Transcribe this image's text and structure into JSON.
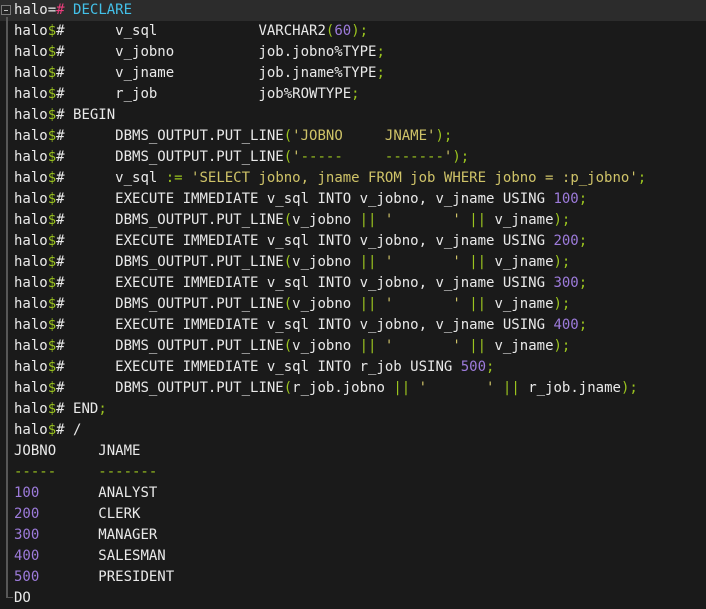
{
  "terminal": {
    "colors": {
      "background": "#1a1a1a",
      "active_line_background": "#2c2c2c",
      "fg": "#e9e9e9",
      "green": "#9bc41f",
      "pink": "#ee3d7d",
      "cyan": "#43c1e9",
      "yellow": "#cfc368",
      "purple": "#9d7bdb",
      "gutter": "#575757"
    },
    "gutter": {
      "fold_marker": "collapse-minus-box",
      "guide": "vertical-line-with-corner-foot"
    },
    "prompt": {
      "primary": "halo=#",
      "continuation": "halo$#"
    },
    "lines": [
      {
        "highlight": true,
        "segs": [
          {
            "t": "halo=",
            "c": "fg"
          },
          {
            "t": "#",
            "c": "pink"
          },
          {
            "t": " ",
            "c": "fg"
          },
          {
            "t": "DECLARE",
            "c": "cyan"
          }
        ]
      },
      {
        "segs": [
          {
            "t": "halo",
            "c": "fg"
          },
          {
            "t": "$",
            "c": "green"
          },
          {
            "t": "# ",
            "c": "fg"
          },
          {
            "t": "     v_sql            VARCHAR2",
            "c": "fg"
          },
          {
            "t": "(",
            "c": "green"
          },
          {
            "t": "60",
            "c": "purple"
          },
          {
            "t": ");",
            "c": "green"
          }
        ]
      },
      {
        "segs": [
          {
            "t": "halo",
            "c": "fg"
          },
          {
            "t": "$",
            "c": "green"
          },
          {
            "t": "# ",
            "c": "fg"
          },
          {
            "t": "     v_jobno          job.jobno%TYPE",
            "c": "fg"
          },
          {
            "t": ";",
            "c": "green"
          }
        ]
      },
      {
        "segs": [
          {
            "t": "halo",
            "c": "fg"
          },
          {
            "t": "$",
            "c": "green"
          },
          {
            "t": "# ",
            "c": "fg"
          },
          {
            "t": "     v_jname          job.jname%TYPE",
            "c": "fg"
          },
          {
            "t": ";",
            "c": "green"
          }
        ]
      },
      {
        "segs": [
          {
            "t": "halo",
            "c": "fg"
          },
          {
            "t": "$",
            "c": "green"
          },
          {
            "t": "# ",
            "c": "fg"
          },
          {
            "t": "     r_job            job%ROWTYPE",
            "c": "fg"
          },
          {
            "t": ";",
            "c": "green"
          }
        ]
      },
      {
        "segs": [
          {
            "t": "halo",
            "c": "fg"
          },
          {
            "t": "$",
            "c": "green"
          },
          {
            "t": "# ",
            "c": "fg"
          },
          {
            "t": "BEGIN",
            "c": "fg"
          }
        ]
      },
      {
        "segs": [
          {
            "t": "halo",
            "c": "fg"
          },
          {
            "t": "$",
            "c": "green"
          },
          {
            "t": "# ",
            "c": "fg"
          },
          {
            "t": "     DBMS_OUTPUT.PUT_LINE",
            "c": "fg"
          },
          {
            "t": "(",
            "c": "green"
          },
          {
            "t": "'JOBNO     JNAME'",
            "c": "yellow"
          },
          {
            "t": ");",
            "c": "green"
          }
        ]
      },
      {
        "segs": [
          {
            "t": "halo",
            "c": "fg"
          },
          {
            "t": "$",
            "c": "green"
          },
          {
            "t": "# ",
            "c": "fg"
          },
          {
            "t": "     DBMS_OUTPUT.PUT_LINE",
            "c": "fg"
          },
          {
            "t": "(",
            "c": "green"
          },
          {
            "t": "'",
            "c": "yellow"
          },
          {
            "t": "-----     -------",
            "c": "green"
          },
          {
            "t": "'",
            "c": "yellow"
          },
          {
            "t": ");",
            "c": "green"
          }
        ]
      },
      {
        "segs": [
          {
            "t": "halo",
            "c": "fg"
          },
          {
            "t": "$",
            "c": "green"
          },
          {
            "t": "# ",
            "c": "fg"
          },
          {
            "t": "     v_sql ",
            "c": "fg"
          },
          {
            "t": ":=",
            "c": "green"
          },
          {
            "t": " ",
            "c": "fg"
          },
          {
            "t": "'SELECT jobno, jname FROM job WHERE jobno = :p_jobno'",
            "c": "yellow"
          },
          {
            "t": ";",
            "c": "green"
          }
        ]
      },
      {
        "segs": [
          {
            "t": "halo",
            "c": "fg"
          },
          {
            "t": "$",
            "c": "green"
          },
          {
            "t": "# ",
            "c": "fg"
          },
          {
            "t": "     EXECUTE IMMEDIATE v_sql INTO v_jobno, v_jname USING ",
            "c": "fg"
          },
          {
            "t": "100",
            "c": "purple"
          },
          {
            "t": ";",
            "c": "green"
          }
        ]
      },
      {
        "segs": [
          {
            "t": "halo",
            "c": "fg"
          },
          {
            "t": "$",
            "c": "green"
          },
          {
            "t": "# ",
            "c": "fg"
          },
          {
            "t": "     DBMS_OUTPUT.PUT_LINE",
            "c": "fg"
          },
          {
            "t": "(",
            "c": "green"
          },
          {
            "t": "v_jobno ",
            "c": "fg"
          },
          {
            "t": "||",
            "c": "green"
          },
          {
            "t": " ",
            "c": "fg"
          },
          {
            "t": "'       '",
            "c": "yellow"
          },
          {
            "t": " ",
            "c": "fg"
          },
          {
            "t": "||",
            "c": "green"
          },
          {
            "t": " v_jname",
            "c": "fg"
          },
          {
            "t": ");",
            "c": "green"
          }
        ]
      },
      {
        "segs": [
          {
            "t": "halo",
            "c": "fg"
          },
          {
            "t": "$",
            "c": "green"
          },
          {
            "t": "# ",
            "c": "fg"
          },
          {
            "t": "     EXECUTE IMMEDIATE v_sql INTO v_jobno, v_jname USING ",
            "c": "fg"
          },
          {
            "t": "200",
            "c": "purple"
          },
          {
            "t": ";",
            "c": "green"
          }
        ]
      },
      {
        "segs": [
          {
            "t": "halo",
            "c": "fg"
          },
          {
            "t": "$",
            "c": "green"
          },
          {
            "t": "# ",
            "c": "fg"
          },
          {
            "t": "     DBMS_OUTPUT.PUT_LINE",
            "c": "fg"
          },
          {
            "t": "(",
            "c": "green"
          },
          {
            "t": "v_jobno ",
            "c": "fg"
          },
          {
            "t": "||",
            "c": "green"
          },
          {
            "t": " ",
            "c": "fg"
          },
          {
            "t": "'       '",
            "c": "yellow"
          },
          {
            "t": " ",
            "c": "fg"
          },
          {
            "t": "||",
            "c": "green"
          },
          {
            "t": " v_jname",
            "c": "fg"
          },
          {
            "t": ");",
            "c": "green"
          }
        ]
      },
      {
        "segs": [
          {
            "t": "halo",
            "c": "fg"
          },
          {
            "t": "$",
            "c": "green"
          },
          {
            "t": "# ",
            "c": "fg"
          },
          {
            "t": "     EXECUTE IMMEDIATE v_sql INTO v_jobno, v_jname USING ",
            "c": "fg"
          },
          {
            "t": "300",
            "c": "purple"
          },
          {
            "t": ";",
            "c": "green"
          }
        ]
      },
      {
        "segs": [
          {
            "t": "halo",
            "c": "fg"
          },
          {
            "t": "$",
            "c": "green"
          },
          {
            "t": "# ",
            "c": "fg"
          },
          {
            "t": "     DBMS_OUTPUT.PUT_LINE",
            "c": "fg"
          },
          {
            "t": "(",
            "c": "green"
          },
          {
            "t": "v_jobno ",
            "c": "fg"
          },
          {
            "t": "||",
            "c": "green"
          },
          {
            "t": " ",
            "c": "fg"
          },
          {
            "t": "'       '",
            "c": "yellow"
          },
          {
            "t": " ",
            "c": "fg"
          },
          {
            "t": "||",
            "c": "green"
          },
          {
            "t": " v_jname",
            "c": "fg"
          },
          {
            "t": ");",
            "c": "green"
          }
        ]
      },
      {
        "segs": [
          {
            "t": "halo",
            "c": "fg"
          },
          {
            "t": "$",
            "c": "green"
          },
          {
            "t": "# ",
            "c": "fg"
          },
          {
            "t": "     EXECUTE IMMEDIATE v_sql INTO v_jobno, v_jname USING ",
            "c": "fg"
          },
          {
            "t": "400",
            "c": "purple"
          },
          {
            "t": ";",
            "c": "green"
          }
        ]
      },
      {
        "segs": [
          {
            "t": "halo",
            "c": "fg"
          },
          {
            "t": "$",
            "c": "green"
          },
          {
            "t": "# ",
            "c": "fg"
          },
          {
            "t": "     DBMS_OUTPUT.PUT_LINE",
            "c": "fg"
          },
          {
            "t": "(",
            "c": "green"
          },
          {
            "t": "v_jobno ",
            "c": "fg"
          },
          {
            "t": "||",
            "c": "green"
          },
          {
            "t": " ",
            "c": "fg"
          },
          {
            "t": "'       '",
            "c": "yellow"
          },
          {
            "t": " ",
            "c": "fg"
          },
          {
            "t": "||",
            "c": "green"
          },
          {
            "t": " v_jname",
            "c": "fg"
          },
          {
            "t": ");",
            "c": "green"
          }
        ]
      },
      {
        "segs": [
          {
            "t": "halo",
            "c": "fg"
          },
          {
            "t": "$",
            "c": "green"
          },
          {
            "t": "# ",
            "c": "fg"
          },
          {
            "t": "     EXECUTE IMMEDIATE v_sql INTO r_job USING ",
            "c": "fg"
          },
          {
            "t": "500",
            "c": "purple"
          },
          {
            "t": ";",
            "c": "green"
          }
        ]
      },
      {
        "segs": [
          {
            "t": "halo",
            "c": "fg"
          },
          {
            "t": "$",
            "c": "green"
          },
          {
            "t": "# ",
            "c": "fg"
          },
          {
            "t": "     DBMS_OUTPUT.PUT_LINE",
            "c": "fg"
          },
          {
            "t": "(",
            "c": "green"
          },
          {
            "t": "r_job.jobno ",
            "c": "fg"
          },
          {
            "t": "||",
            "c": "green"
          },
          {
            "t": " ",
            "c": "fg"
          },
          {
            "t": "'       '",
            "c": "yellow"
          },
          {
            "t": " ",
            "c": "fg"
          },
          {
            "t": "||",
            "c": "green"
          },
          {
            "t": " r_job.jname",
            "c": "fg"
          },
          {
            "t": ");",
            "c": "green"
          }
        ]
      },
      {
        "segs": [
          {
            "t": "halo",
            "c": "fg"
          },
          {
            "t": "$",
            "c": "green"
          },
          {
            "t": "# ",
            "c": "fg"
          },
          {
            "t": "END",
            "c": "fg"
          },
          {
            "t": ";",
            "c": "green"
          }
        ]
      },
      {
        "segs": [
          {
            "t": "halo",
            "c": "fg"
          },
          {
            "t": "$",
            "c": "green"
          },
          {
            "t": "# ",
            "c": "fg"
          },
          {
            "t": "/",
            "c": "fg"
          }
        ]
      },
      {
        "segs": [
          {
            "t": "JOBNO     JNAME",
            "c": "fg"
          }
        ]
      },
      {
        "segs": [
          {
            "t": "-----     -------",
            "c": "green"
          }
        ]
      },
      {
        "segs": [
          {
            "t": "100",
            "c": "purple"
          },
          {
            "t": "       ANALYST",
            "c": "fg"
          }
        ]
      },
      {
        "segs": [
          {
            "t": "200",
            "c": "purple"
          },
          {
            "t": "       CLERK",
            "c": "fg"
          }
        ]
      },
      {
        "segs": [
          {
            "t": "300",
            "c": "purple"
          },
          {
            "t": "       MANAGER",
            "c": "fg"
          }
        ]
      },
      {
        "segs": [
          {
            "t": "400",
            "c": "purple"
          },
          {
            "t": "       SALESMAN",
            "c": "fg"
          }
        ]
      },
      {
        "segs": [
          {
            "t": "500",
            "c": "purple"
          },
          {
            "t": "       PRESIDENT",
            "c": "fg"
          }
        ]
      },
      {
        "corner": true,
        "segs": [
          {
            "t": "DO",
            "c": "fg"
          }
        ]
      }
    ]
  }
}
